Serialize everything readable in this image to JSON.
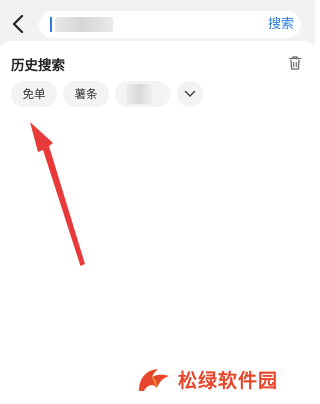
{
  "header": {
    "back_icon": "chevron-left-icon",
    "search": {
      "value": "",
      "placeholder": ""
    },
    "search_label": "搜索",
    "accent_color": "#2a7de1"
  },
  "history": {
    "title": "历史搜索",
    "delete_icon": "trash-icon",
    "items": [
      {
        "label": "免单"
      },
      {
        "label": "薯条"
      },
      {
        "label": ""
      }
    ],
    "expand_icon": "chevron-down-icon"
  },
  "annotation": {
    "color": "#e83a3a",
    "icon": "red-arrow-icon"
  },
  "watermark": {
    "text": "松绿软件园",
    "color": "#e8462a",
    "icon": "logo-icon"
  }
}
